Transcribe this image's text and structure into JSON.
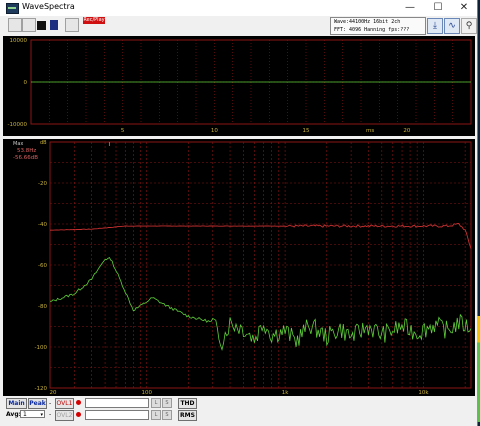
{
  "window": {
    "title": "WaveSpectra",
    "minimize": "—",
    "maximize": "☐",
    "close": "✕"
  },
  "toolbar": {
    "rec_indicator": "Rec/Play",
    "info_line1": "Wave:44100Hz 16bit 2ch",
    "info_line2": "FFT: 4096 Hanning  fps:???"
  },
  "wave_panel": {
    "y_ticks": [
      "10000",
      "0",
      "-10000"
    ],
    "x_ticks": [
      "5",
      "10",
      "15",
      "ms",
      "20"
    ]
  },
  "spectrum_panel": {
    "marker_label": "Max",
    "marker_freq": "53.8Hz",
    "marker_level": "-56.66dB",
    "db_unit": "dB",
    "y_ticks": [
      "-20",
      "-40",
      "-60",
      "-80",
      "-100",
      "-120"
    ],
    "x_ticks": [
      "20",
      "100",
      "1k",
      "10k"
    ]
  },
  "bottom": {
    "main_label": "Main",
    "peak_label": "Peak",
    "ovl1_label": "OVL1",
    "ovl2_label": "OVL2",
    "avg_label": "Avg:",
    "avg_value": "1",
    "dash1": "-",
    "dash2": "-",
    "l_label": "L",
    "s_label": "S",
    "thd_label": "THD",
    "rms_label": "RMS"
  },
  "colors": {
    "grid": "#8a1414",
    "trace_red": "#c83030",
    "trace_green": "#5ed03a",
    "axis_text": "#c8b23a"
  },
  "chart_data": [
    {
      "type": "line",
      "title": "",
      "xlabel": "ms",
      "ylabel": "",
      "x": [
        0,
        24
      ],
      "series": [
        {
          "values": [
            0,
            0
          ]
        }
      ],
      "ylim": [
        -10000,
        10000
      ]
    },
    {
      "type": "line",
      "title": "",
      "xlabel": "",
      "ylabel": "dB",
      "log_x": true,
      "xlim": [
        20,
        22050
      ],
      "ylim": [
        -120,
        0
      ],
      "series": [
        {
          "color": "#c83030",
          "points": [
            [
              20,
              -43
            ],
            [
              40,
              -42.5
            ],
            [
              70,
              -41
            ],
            [
              200,
              -41
            ],
            [
              1000,
              -41
            ],
            [
              5000,
              -41
            ],
            [
              10000,
              -41
            ],
            [
              15000,
              -41
            ],
            [
              18000,
              -40
            ],
            [
              20000,
              -43
            ],
            [
              22050,
              -52
            ]
          ]
        },
        {
          "color": "#5ed03a",
          "points": [
            [
              20,
              -78
            ],
            [
              30,
              -74
            ],
            [
              40,
              -67
            ],
            [
              50,
              -57
            ],
            [
              55,
              -57
            ],
            [
              65,
              -68
            ],
            [
              80,
              -82
            ],
            [
              90,
              -80
            ],
            [
              110,
              -76
            ],
            [
              140,
              -80
            ],
            [
              200,
              -85
            ],
            [
              300,
              -88
            ],
            [
              350,
              -97
            ],
            [
              400,
              -88
            ],
            [
              500,
              -91
            ],
            [
              600,
              -96
            ],
            [
              700,
              -88
            ],
            [
              800,
              -94
            ],
            [
              1000,
              -92
            ],
            [
              1200,
              -97
            ],
            [
              1500,
              -89
            ],
            [
              2000,
              -95
            ],
            [
              2500,
              -91
            ],
            [
              3000,
              -95
            ],
            [
              4000,
              -90
            ],
            [
              5000,
              -94
            ],
            [
              7000,
              -90
            ],
            [
              9000,
              -93
            ],
            [
              12000,
              -89
            ],
            [
              15000,
              -92
            ],
            [
              18000,
              -88
            ],
            [
              22050,
              -91
            ]
          ]
        }
      ]
    }
  ]
}
